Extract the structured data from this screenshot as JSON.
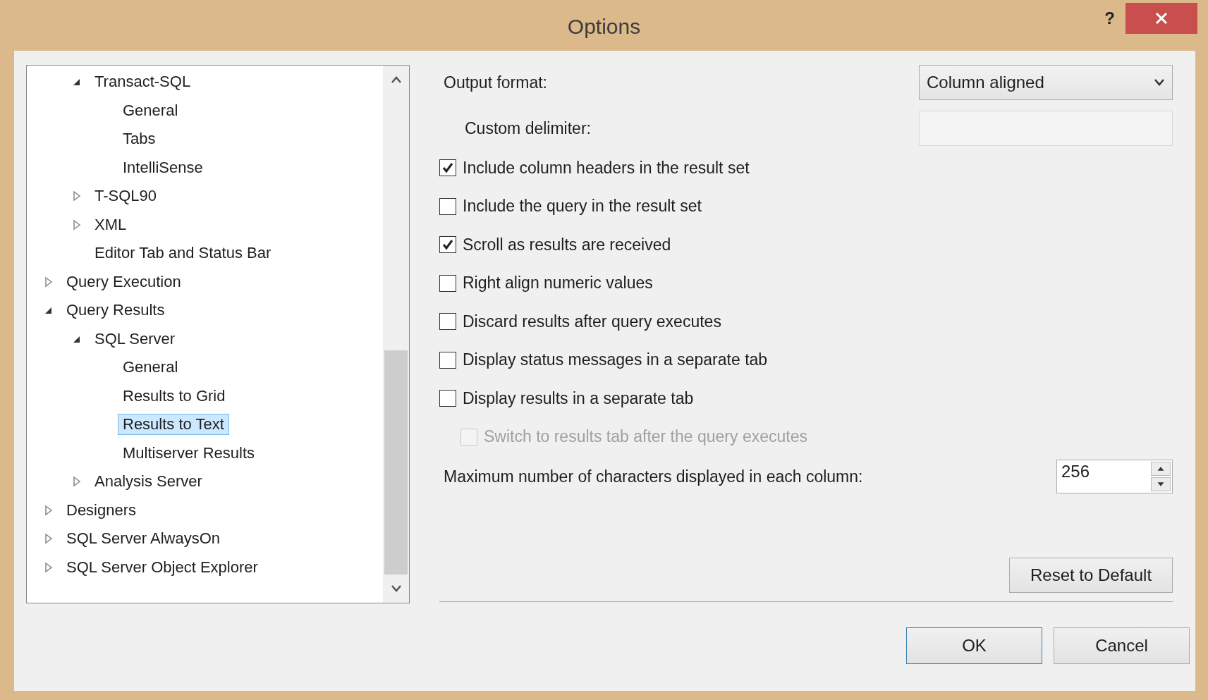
{
  "window": {
    "title": "Options",
    "help_button": "?"
  },
  "tree": {
    "items": [
      {
        "children": [
          {
            "label": "Transact-SQL",
            "expanded": true,
            "selected": false,
            "children": [
              {
                "label": "General",
                "selected": false
              },
              {
                "label": "Tabs",
                "selected": false
              },
              {
                "label": "IntelliSense",
                "selected": false
              }
            ]
          },
          {
            "label": "T-SQL90",
            "expanded": false,
            "selected": false
          },
          {
            "label": "XML",
            "expanded": false,
            "selected": false
          },
          {
            "label": "Editor Tab and Status Bar",
            "selected": false
          }
        ]
      },
      {
        "label": "Query Execution",
        "expanded": false,
        "selected": false
      },
      {
        "label": "Query Results",
        "expanded": true,
        "selected": false,
        "children": [
          {
            "label": "SQL Server",
            "expanded": true,
            "selected": false,
            "children": [
              {
                "label": "General",
                "selected": false
              },
              {
                "label": "Results to Grid",
                "selected": false
              },
              {
                "label": "Results to Text",
                "selected": true
              },
              {
                "label": "Multiserver Results",
                "selected": false
              }
            ]
          },
          {
            "label": "Analysis Server",
            "expanded": false,
            "selected": false
          }
        ]
      },
      {
        "label": "Designers",
        "expanded": false,
        "selected": false
      },
      {
        "label": "SQL Server AlwaysOn",
        "expanded": false,
        "selected": false
      },
      {
        "label": "SQL Server Object Explorer",
        "expanded": false,
        "selected": false
      }
    ]
  },
  "output_format": {
    "label": "Output format:",
    "value": "Column aligned"
  },
  "custom_delimiter": {
    "label": "Custom delimiter:",
    "disabled": true
  },
  "checkboxes": [
    {
      "label": "Include column headers in the result set",
      "checked": true,
      "disabled": false
    },
    {
      "label": "Include the query in the result set",
      "checked": false,
      "disabled": false
    },
    {
      "label": "Scroll as results are received",
      "checked": true,
      "disabled": false
    },
    {
      "label": "Right align numeric values",
      "checked": false,
      "disabled": false
    },
    {
      "label": "Discard results after query executes",
      "checked": false,
      "disabled": false
    },
    {
      "label": "Display status messages in a separate tab",
      "checked": false,
      "disabled": false
    },
    {
      "label": "Display results in a separate tab",
      "checked": false,
      "disabled": false
    },
    {
      "label": "Switch to results tab after the query executes",
      "checked": false,
      "disabled": true
    }
  ],
  "max_chars": {
    "label": "Maximum number of characters displayed in each column:",
    "value": "256"
  },
  "buttons": {
    "reset": "Reset to Default",
    "ok": "OK",
    "cancel": "Cancel"
  }
}
